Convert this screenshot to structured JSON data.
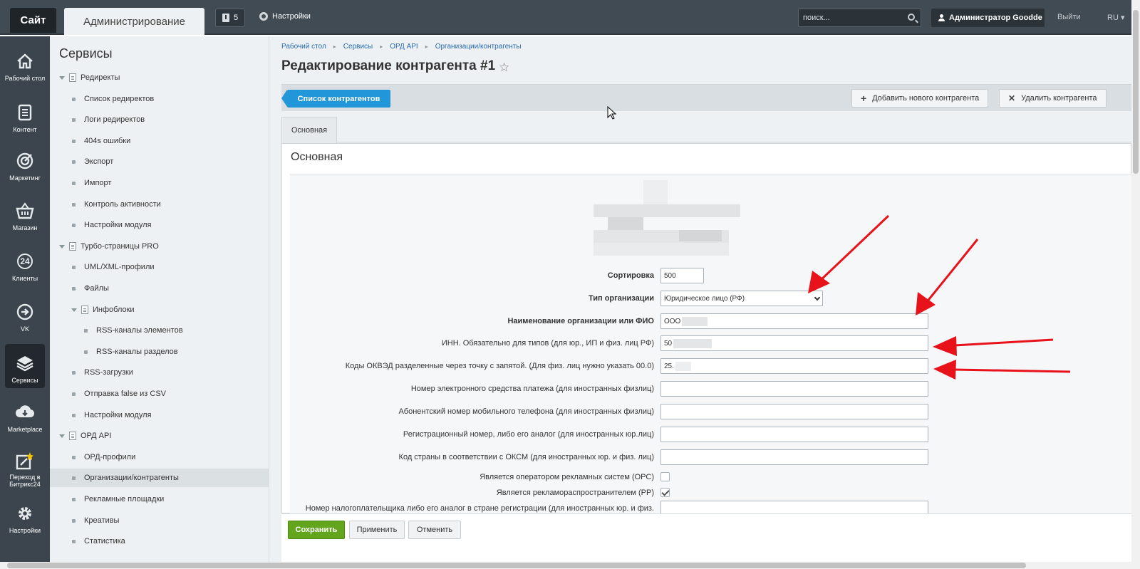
{
  "topbar": {
    "site_tab": "Сайт",
    "admin_tab": "Администрирование",
    "notifications_count": "5",
    "settings_label": "Настройки",
    "search_placeholder": "поиск...",
    "user_label": "Администратор Goodde",
    "logout_label": "Выйти",
    "lang_label": "RU"
  },
  "iconbar": {
    "items": [
      {
        "label": "Рабочий стол",
        "icon": "home-icon"
      },
      {
        "label": "Контент",
        "icon": "document-icon"
      },
      {
        "label": "Маркетинг",
        "icon": "target-icon"
      },
      {
        "label": "Магазин",
        "icon": "basket-icon"
      },
      {
        "label": "Клиенты",
        "icon": "clients-24-icon",
        "glyph": "24"
      },
      {
        "label": "VK",
        "icon": "vk-arrow-icon"
      },
      {
        "label": "Сервисы",
        "icon": "layers-icon",
        "active": true
      },
      {
        "label": "Marketplace",
        "icon": "cloud-download-icon"
      },
      {
        "label": "Переход в Битрикс24",
        "icon": "bitrix24-icon"
      },
      {
        "label": "Настройки",
        "icon": "gear-icon"
      }
    ]
  },
  "sidebar": {
    "title": "Сервисы",
    "items": [
      {
        "label": "Редиректы",
        "level": 0,
        "type": "folder"
      },
      {
        "label": "Список редиректов",
        "level": 1,
        "type": "leaf"
      },
      {
        "label": "Логи редиректов",
        "level": 1,
        "type": "leaf"
      },
      {
        "label": "404s ошибки",
        "level": 1,
        "type": "leaf"
      },
      {
        "label": "Экспорт",
        "level": 1,
        "type": "leaf"
      },
      {
        "label": "Импорт",
        "level": 1,
        "type": "leaf"
      },
      {
        "label": "Контроль активности",
        "level": 1,
        "type": "leaf"
      },
      {
        "label": "Настройки модуля",
        "level": 1,
        "type": "leaf"
      },
      {
        "label": "Турбо-страницы PRO",
        "level": 0,
        "type": "folder"
      },
      {
        "label": "UML/XML-профили",
        "level": 1,
        "type": "leaf"
      },
      {
        "label": "Файлы",
        "level": 1,
        "type": "leaf"
      },
      {
        "label": "Инфоблоки",
        "level": 1,
        "type": "folder"
      },
      {
        "label": "RSS-каналы элементов",
        "level": 2,
        "type": "leaf"
      },
      {
        "label": "RSS-каналы разделов",
        "level": 2,
        "type": "leaf"
      },
      {
        "label": "RSS-загрузки",
        "level": 1,
        "type": "leaf"
      },
      {
        "label": "Отправка false из CSV",
        "level": 1,
        "type": "leaf"
      },
      {
        "label": "Настройки модуля",
        "level": 1,
        "type": "leaf"
      },
      {
        "label": "ОРД API",
        "level": 0,
        "type": "folder"
      },
      {
        "label": "ОРД-профили",
        "level": 1,
        "type": "leaf"
      },
      {
        "label": "Организации/контрагенты",
        "level": 1,
        "type": "leaf",
        "active": true
      },
      {
        "label": "Рекламные площадки",
        "level": 1,
        "type": "leaf"
      },
      {
        "label": "Креативы",
        "level": 1,
        "type": "leaf"
      },
      {
        "label": "Статистика",
        "level": 1,
        "type": "leaf"
      }
    ]
  },
  "breadcrumb": [
    "Рабочий стол",
    "Сервисы",
    "ОРД API",
    "Организации/контрагенты"
  ],
  "page_title": "Редактирование контрагента #1",
  "toolbar": {
    "list_button": "Список контрагентов",
    "add_button": "Добавить нового контрагента",
    "delete_button": "Удалить контрагента"
  },
  "tabs": [
    "Основная"
  ],
  "panel_title": "Основная",
  "form": {
    "sort": {
      "label": "Сортировка",
      "value": "500"
    },
    "org_type": {
      "label": "Тип организации",
      "value": "Юридическое лицо (РФ)"
    },
    "name": {
      "label": "Наименование организации или ФИО",
      "value": "ООО"
    },
    "inn": {
      "label": "ИНН. Обязательно для типов (для юр., ИП и физ. лиц РФ)",
      "value": "50"
    },
    "okved": {
      "label": "Коды ОКВЭД разделенные через точку с запятой. (Для физ. лиц нужно указать 00.0)",
      "value": "25."
    },
    "payment_number": {
      "label": "Номер электронного средства платежа (для иностранных физлиц)",
      "value": ""
    },
    "phone": {
      "label": "Абонентский номер мобильного телефона (для иностранных физлиц)",
      "value": ""
    },
    "reg_number": {
      "label": "Регистрационный номер, либо его аналог (для иностранных юр.лиц)",
      "value": ""
    },
    "country_code": {
      "label": "Код страны в соответствии с ОКСМ (для иностранных юр. и физ. лиц)",
      "value": ""
    },
    "is_ors": {
      "label": "Является оператором рекламных систем (ОРС)",
      "checked": false
    },
    "is_rr": {
      "label": "Является рекламораспространителем (РР)",
      "checked": true
    },
    "taxpayer_number": {
      "label": "Номер налогоплательщика либо его аналог в стране регистрации (для иностранных юр. и физ.",
      "value": ""
    }
  },
  "footer": {
    "save": "Сохранить",
    "apply": "Применить",
    "cancel": "Отменить"
  },
  "colors": {
    "accent_blue": "#2196d8",
    "save_green": "#64a51e",
    "annotation_red": "#e8121b"
  }
}
